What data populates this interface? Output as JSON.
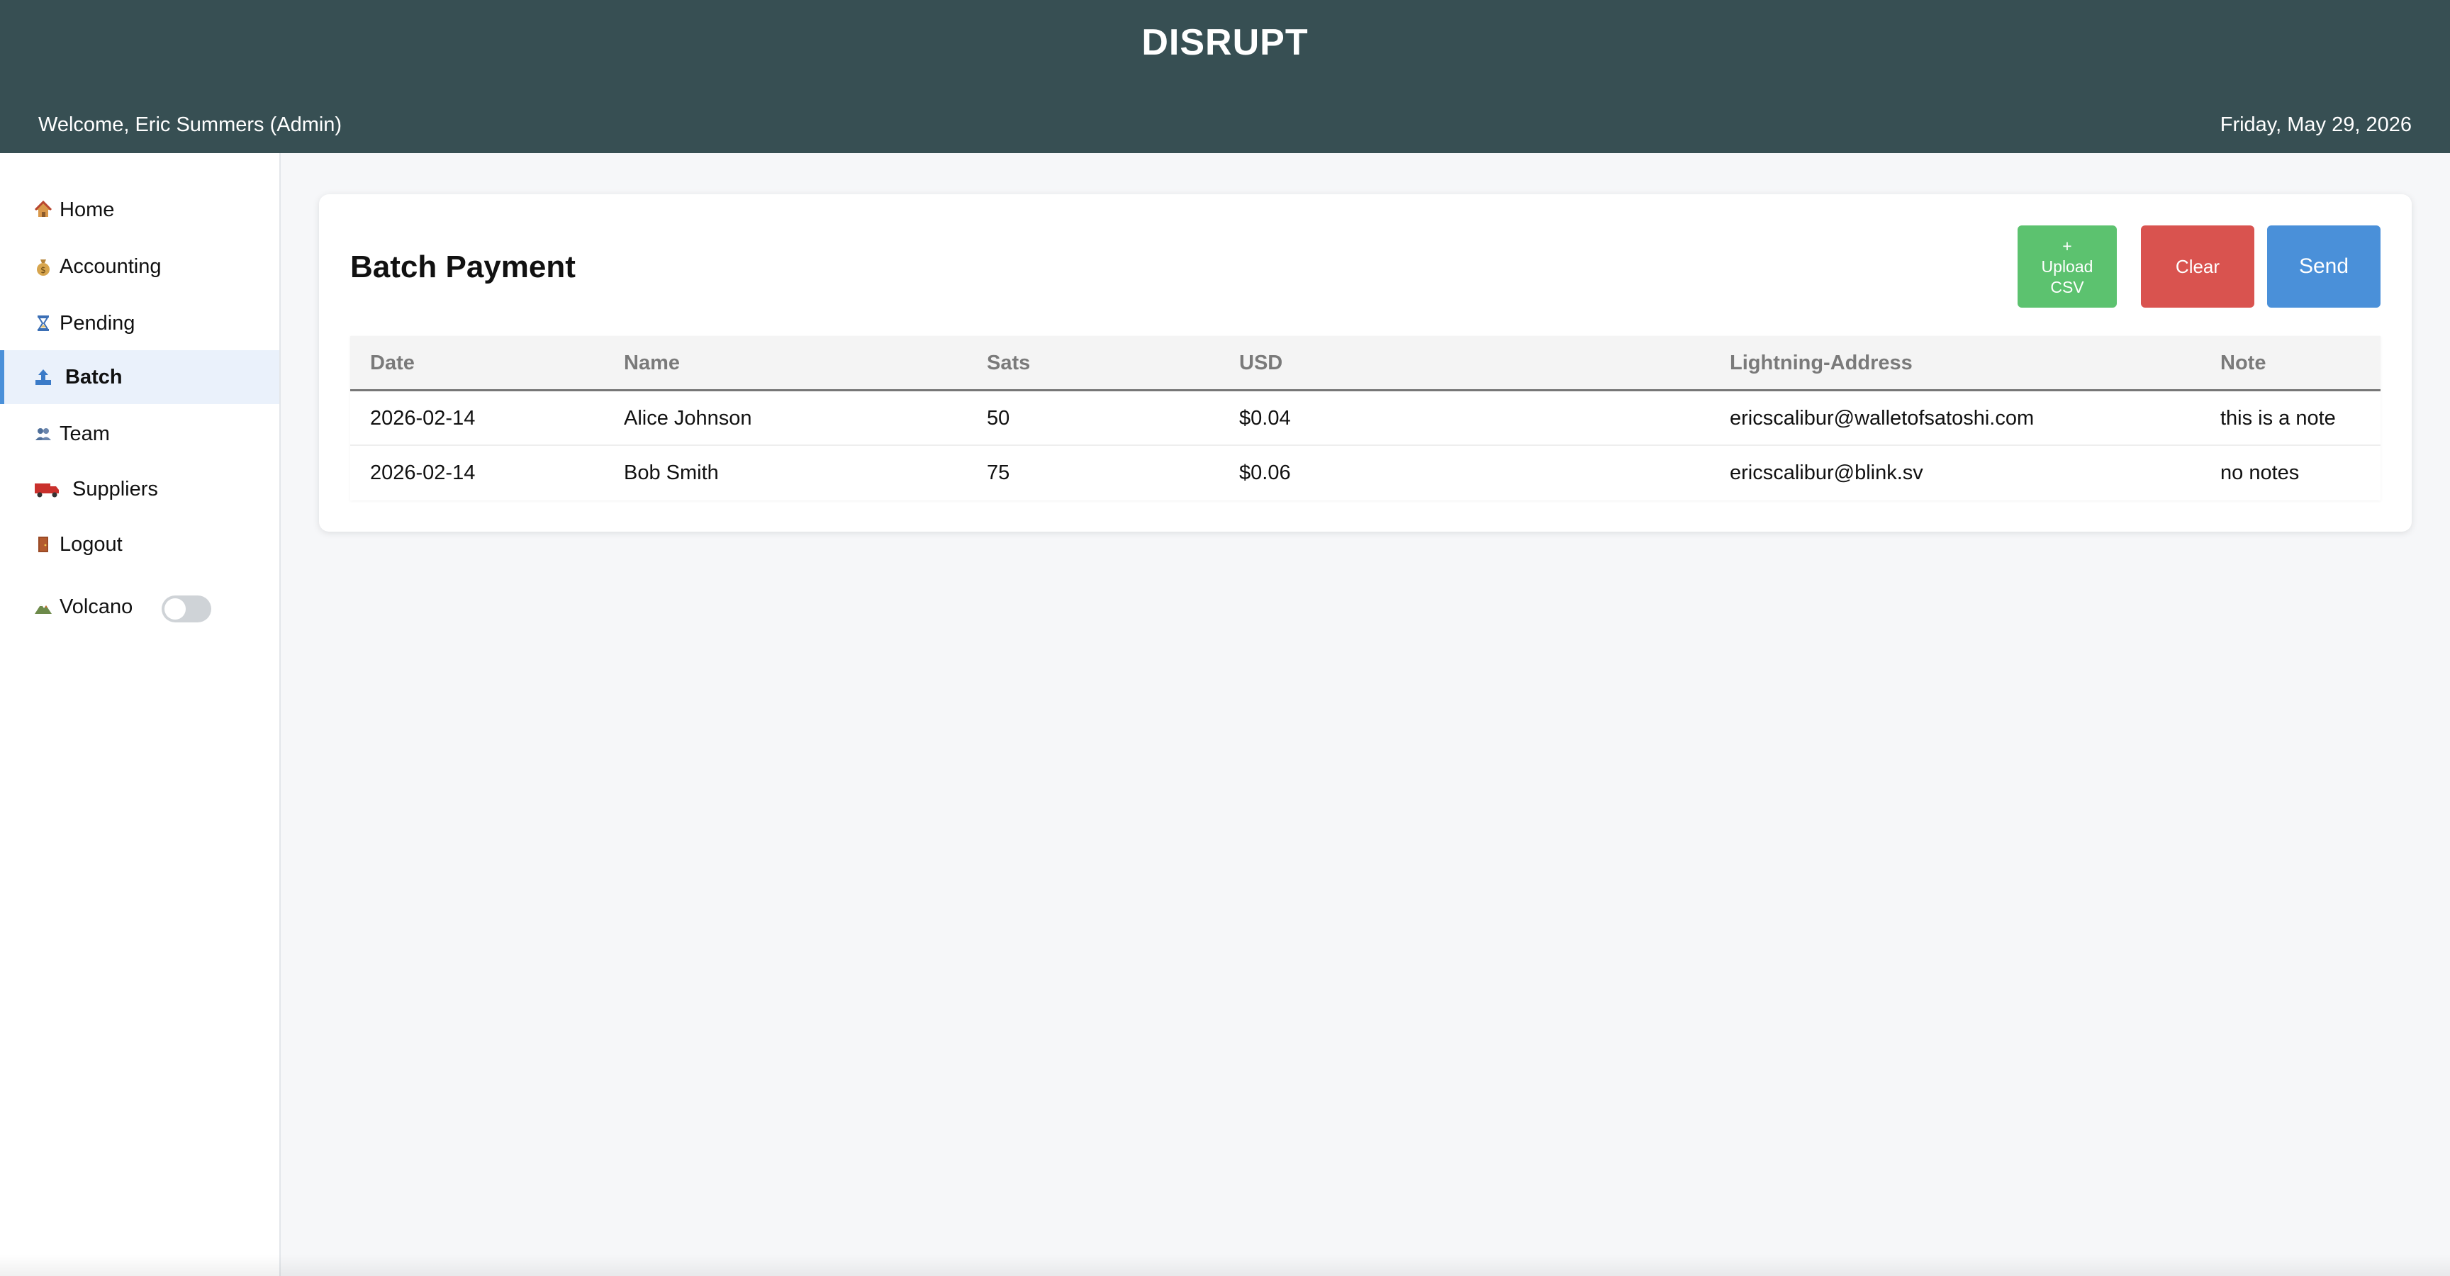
{
  "header": {
    "brand": "DISRUPT",
    "welcome": "Welcome, Eric Summers (Admin)",
    "date": "Friday, May 29, 2026",
    "background": "#374f53"
  },
  "sidebar": {
    "items": [
      {
        "label": "Home",
        "icon": "house-icon"
      },
      {
        "label": "Accounting",
        "icon": "money-bag-icon"
      },
      {
        "label": "Pending",
        "icon": "hourglass-icon"
      },
      {
        "label": "Batch",
        "icon": "upload-icon",
        "active": true
      },
      {
        "label": "Team",
        "icon": "people-icon"
      },
      {
        "label": "Suppliers",
        "icon": "delivery-truck-icon"
      },
      {
        "label": "Logout",
        "icon": "door-icon"
      }
    ],
    "volcano": {
      "label": "Volcano",
      "icon": "mountain-icon",
      "enabled": false
    }
  },
  "main": {
    "title": "Batch Payment",
    "buttons": {
      "upload": {
        "plus": "+",
        "line1": "Upload",
        "line2": "CSV",
        "color": "#5cc26f"
      },
      "clear": {
        "label": "Clear",
        "color": "#d9534f"
      },
      "send": {
        "label": "Send",
        "color": "#4a90d9"
      }
    },
    "table": {
      "headers": [
        "Date",
        "Name",
        "Sats",
        "USD",
        "Lightning-Address",
        "Note"
      ],
      "rows": [
        [
          "2026-02-14",
          "Alice Johnson",
          "50",
          "$0.04",
          "ericscalibur@walletofsatoshi.com",
          "this is a note"
        ],
        [
          "2026-02-14",
          "Bob Smith",
          "75",
          "$0.06",
          "ericscalibur@blink.sv",
          "no notes"
        ]
      ]
    }
  }
}
